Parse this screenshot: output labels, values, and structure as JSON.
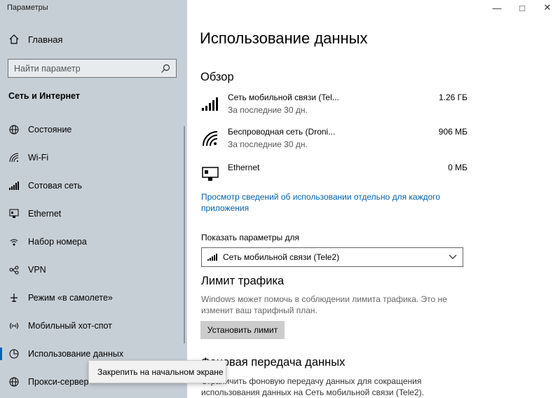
{
  "app": {
    "title": "Параметры"
  },
  "sidebar": {
    "home_label": "Главная",
    "search_placeholder": "Найти параметр",
    "section_title": "Сеть и Интернет",
    "items": [
      {
        "label": "Состояние",
        "icon": "globe-icon"
      },
      {
        "label": "Wi-Fi",
        "icon": "wifi-icon"
      },
      {
        "label": "Сотовая сеть",
        "icon": "cellular-icon"
      },
      {
        "label": "Ethernet",
        "icon": "ethernet-icon"
      },
      {
        "label": "Набор номера",
        "icon": "dialup-icon"
      },
      {
        "label": "VPN",
        "icon": "vpn-icon"
      },
      {
        "label": "Режим «в самолете»",
        "icon": "airplane-icon"
      },
      {
        "label": "Мобильный хот-спот",
        "icon": "hotspot-icon"
      },
      {
        "label": "Использование данных",
        "icon": "data-usage-icon",
        "active": true
      },
      {
        "label": "Прокси-сервер",
        "icon": "globe-icon"
      }
    ]
  },
  "popup": {
    "label": "Закрепить на начальном экране"
  },
  "main": {
    "title": "Использование данных",
    "overview_title": "Обзор",
    "usage": [
      {
        "name": "Сеть мобильной связи (Tel...",
        "period": "За последние 30 дн.",
        "value": "1.26 ГБ",
        "icon": "cellular-icon"
      },
      {
        "name": "Беспроводная сеть (Droni...",
        "period": "За последние 30 дн.",
        "value": "906 МБ",
        "icon": "wifi-icon"
      },
      {
        "name": "Ethernet",
        "period": "",
        "value": "0 МБ",
        "icon": "ethernet-icon"
      }
    ],
    "details_link": "Просмотр сведений об использовании отдельно для каждого приложения",
    "show_for_label": "Показать параметры для",
    "show_for_value": "Сеть мобильной связи (Tele2)",
    "limit_title": "Лимит трафика",
    "limit_desc": "Windows может помочь в соблюдении лимита трафика. Это не изменит ваш тарифный план.",
    "limit_button": "Установить лимит",
    "bg_title": "Фоновая передача данных",
    "bg_desc": "Ограничить фоновую передачу данных для сокращения использования данных на Сеть мобильной связи (Tele2)."
  },
  "colors": {
    "sidebar_bg": "#c7cfd6",
    "accent": "#0063b1"
  }
}
